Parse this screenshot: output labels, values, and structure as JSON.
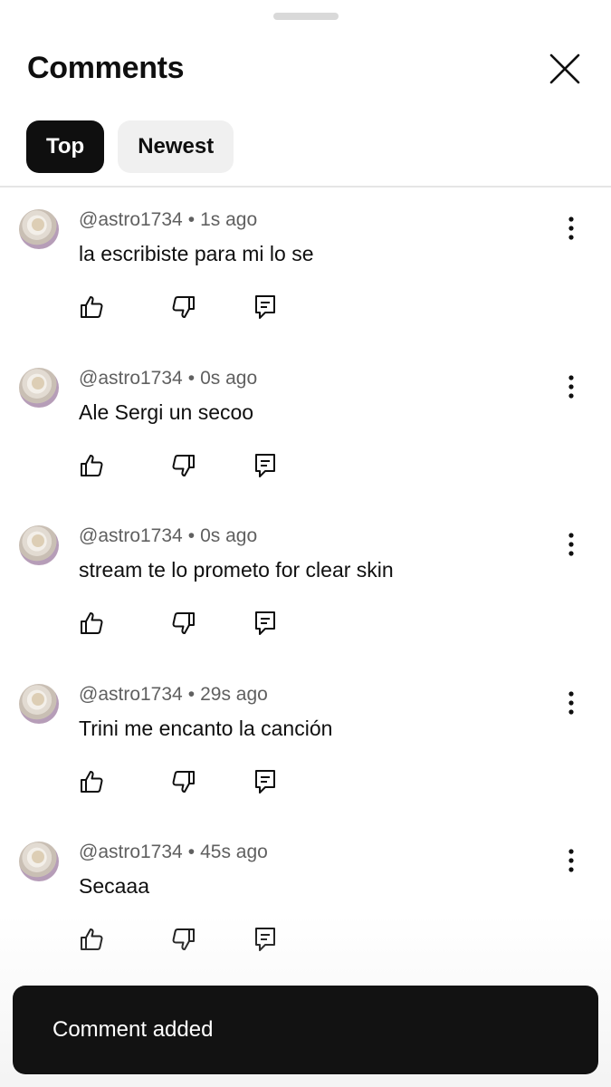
{
  "header": {
    "title": "Comments",
    "close_icon": "close-icon"
  },
  "tabs": [
    {
      "label": "Top",
      "selected": true
    },
    {
      "label": "Newest",
      "selected": false
    }
  ],
  "comments": [
    {
      "author": "@astro1734",
      "separator": "•",
      "time": "1s ago",
      "text": "la escribiste para mi lo se"
    },
    {
      "author": "@astro1734",
      "separator": "•",
      "time": "0s ago",
      "text": "Ale Sergi un secoo"
    },
    {
      "author": "@astro1734",
      "separator": "•",
      "time": "0s ago",
      "text": "stream te lo prometo for clear skin"
    },
    {
      "author": "@astro1734",
      "separator": "•",
      "time": "29s ago",
      "text": "Trini me encanto la canción"
    },
    {
      "author": "@astro1734",
      "separator": "•",
      "time": "45s ago",
      "text": "Secaaa"
    }
  ],
  "icons": {
    "like": "thumbs-up-icon",
    "dislike": "thumbs-down-icon",
    "reply": "reply-icon",
    "more": "more-vertical-icon"
  },
  "toast": {
    "message": "Comment added"
  },
  "colors": {
    "chip_active_bg": "#0f0f0f",
    "chip_inactive_bg": "#f0f0f0",
    "toast_bg": "#121212",
    "meta_text": "#606060"
  }
}
